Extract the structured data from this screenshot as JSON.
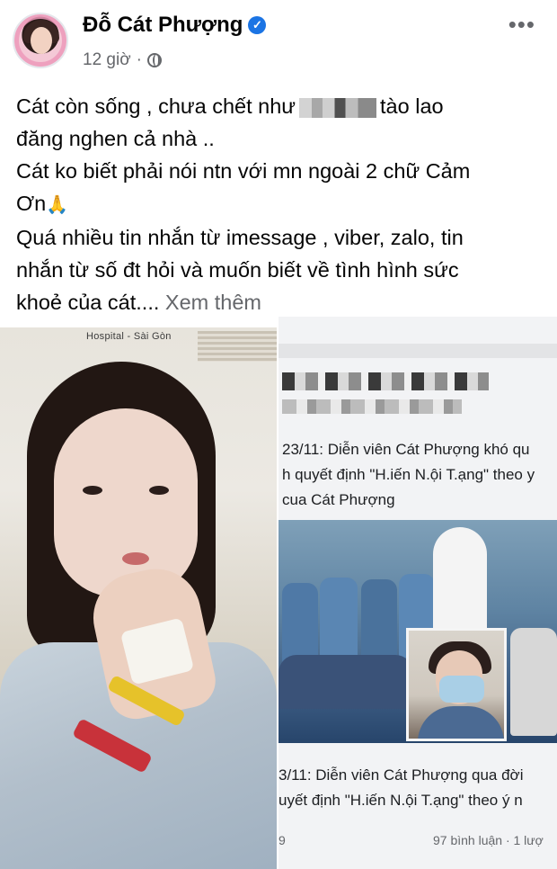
{
  "post": {
    "author": "Đỗ Cát Phượng",
    "time": "12 giờ",
    "more_label": "•••",
    "line1_before": "Cát còn sống , chưa chết như",
    "line1_after": "tào lao",
    "line2": "đăng nghen cả nhà ..",
    "line3": "Cát ko biết phải nói ntn với mn ngoài 2 chữ Cảm",
    "line4": "Ơn",
    "line5": "Quá nhiều tin nhắn từ imessage , viber, zalo, tin",
    "line6": "nhắn từ số đt hỏi và muốn biết về tình hình sức",
    "line7": "khoẻ của cát....",
    "see_more": "Xem thêm"
  },
  "photo_left": {
    "sign": "Hospital - Sài Gòn"
  },
  "photo_right": {
    "caption1_line1": "23/11: Diễn viên Cát Phượng khó qu",
    "caption1_line2": "h quyết định \"H.iến N.ội T.ạng\" theo y",
    "caption1_line3": "cua Cát Phượng",
    "caption2_line1": "3/11: Diễn viên Cát Phượng qua đời",
    "caption2_line2": "uyết định \"H.iến N.ội T.ạng\" theo ý n",
    "footer_left": "9",
    "footer_right": "97 bình luận · 1 lượ"
  },
  "icons": {
    "verified": "verified-badge-icon",
    "globe": "globe-icon",
    "pray": "folded-hands-icon",
    "more": "more-options-icon"
  },
  "colors": {
    "verified_blue": "#1b74e4",
    "meta_gray": "#65676b"
  }
}
